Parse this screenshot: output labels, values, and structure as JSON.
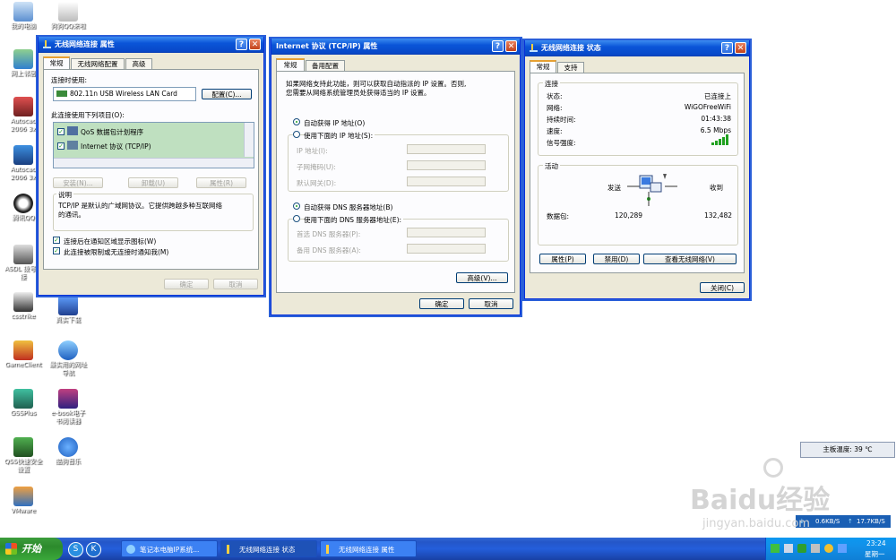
{
  "desktop": {
    "icons": [
      {
        "label": "我的电脑"
      },
      {
        "label": "网上邻居"
      },
      {
        "label": "Autocad 2006 3x"
      },
      {
        "label": "Autocad 2006 3x"
      },
      {
        "label": "腾讯QQ"
      },
      {
        "label": "ASDL 拨号连接"
      },
      {
        "label": "csstrike"
      },
      {
        "label": "GameClient"
      },
      {
        "label": "GSSPlus"
      },
      {
        "label": "QSS快速安全设置"
      },
      {
        "label": "VMware"
      },
      {
        "label": "狗狗QQ来啦"
      },
      {
        "label": "真实下载"
      },
      {
        "label": "最实用的网址导航"
      },
      {
        "label": "e-book电子书阅读器"
      },
      {
        "label": "酷狗音乐"
      }
    ],
    "temp_widget": "主板温度: 39 ℃",
    "net_widget": {
      "down": "0.6KB/S",
      "up": "17.7KB/S"
    },
    "watermark": {
      "brand": "Baidu经验",
      "url": "jingyan.baidu.com"
    }
  },
  "win_props": {
    "title": "无线网络连接  属性",
    "tabs": [
      "常规",
      "无线网络配置",
      "高级"
    ],
    "connect_using_label": "连接时使用:",
    "adapter": "802.11n USB Wireless LAN Card",
    "configure_btn": "配置(C)...",
    "items_label": "此连接使用下列项目(O):",
    "items": [
      "QoS 数据包计划程序",
      "Internet 协议 (TCP/IP)"
    ],
    "install_btn": "安装(N)...",
    "uninstall_btn": "卸载(U)",
    "properties_btn": "属性(R)",
    "desc_label": "说明",
    "desc_text1": "TCP/IP 是默认的广域网协议。它提供跨越多种互联网络",
    "desc_text2": "的通讯。",
    "check1": "连接后在通知区域显示图标(W)",
    "check2": "此连接被限制或无连接时通知我(M)",
    "ok_btn": "确定",
    "cancel_btn": "取消"
  },
  "win_tcpip": {
    "title": "Internet 协议 (TCP/IP) 属性",
    "tabs": [
      "常规",
      "备用配置"
    ],
    "intro1": "如果网络支持此功能，则可以获取自动指派的 IP 设置。否则,",
    "intro2": "您需要从网络系统管理员处获得适当的 IP 设置。",
    "auto_ip": "自动获得 IP 地址(O)",
    "manual_ip": "使用下面的 IP 地址(S):",
    "ip_label": "IP 地址(I):",
    "mask_label": "子网掩码(U):",
    "gateway_label": "默认网关(D):",
    "auto_dns": "自动获得 DNS 服务器地址(B)",
    "manual_dns": "使用下面的 DNS 服务器地址(E):",
    "pref_dns": "首选 DNS 服务器(P):",
    "alt_dns": "备用 DNS 服务器(A):",
    "advanced_btn": "高级(V)...",
    "ok_btn": "确定",
    "cancel_btn": "取消"
  },
  "win_status": {
    "title": "无线网络连接  状态",
    "tabs": [
      "常规",
      "支持"
    ],
    "conn_group": "连接",
    "status_label": "状态:",
    "status_value": "已连接上",
    "network_label": "网络:",
    "network_value": "WiGOFreeWiFi",
    "duration_label": "持续时间:",
    "duration_value": "01:43:38",
    "speed_label": "速度:",
    "speed_value": "6.5 Mbps",
    "signal_label": "信号强度:",
    "activity_group": "活动",
    "sent_label": "发送",
    "recv_label": "收到",
    "packets_label": "数据包:",
    "sent_value": "120,289",
    "recv_value": "132,482",
    "properties_btn": "属性(P)",
    "disable_btn": "禁用(D)",
    "view_btn": "查看无线网络(V)",
    "close_btn": "关闭(C)"
  },
  "taskbar": {
    "start": "开始",
    "tasks": [
      "笔记本电脑IP系统...",
      "无线网络连接 状态",
      "无线网络连接 属性"
    ],
    "clock_time": "23:24",
    "clock_day": "星期一"
  }
}
